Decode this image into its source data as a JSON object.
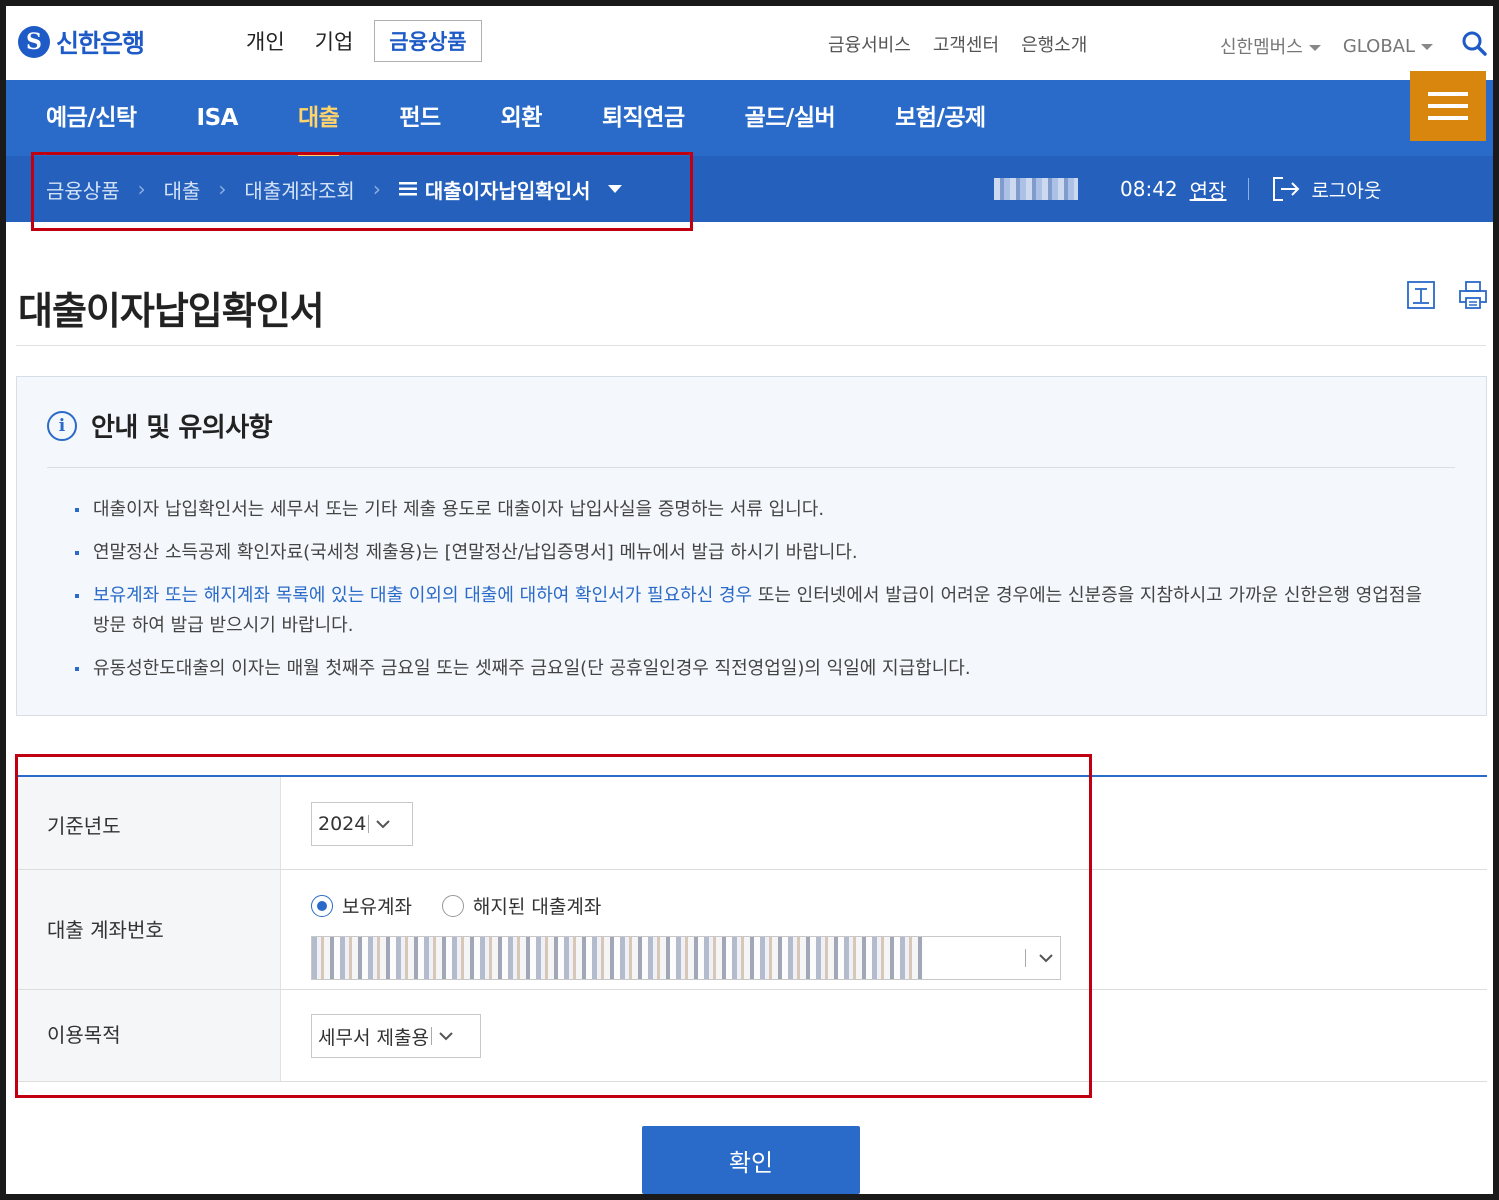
{
  "brand": {
    "name": "신한은행",
    "logo_letter": "S"
  },
  "header": {
    "main_nav": [
      "개인",
      "기업",
      "금융상품"
    ],
    "main_nav_active": "금융상품",
    "util_nav": [
      "금융서비스",
      "고객센터",
      "은행소개"
    ],
    "members": "신한멤버스",
    "global": "GLOBAL"
  },
  "gnb": {
    "items": [
      "예금/신탁",
      "ISA",
      "대출",
      "펀드",
      "외환",
      "퇴직연금",
      "골드/실버",
      "보험/공제"
    ],
    "active": "대출"
  },
  "breadcrumb": {
    "items": [
      "금융상품",
      "대출",
      "대출계좌조회"
    ],
    "current": "대출이자납입확인서"
  },
  "session": {
    "time": "08:42",
    "extend": "연장",
    "logout": "로그아웃"
  },
  "page": {
    "title": "대출이자납입확인서"
  },
  "notice": {
    "title": "안내 및 유의사항",
    "items": [
      "대출이자 납입확인서는 세무서 또는 기타 제출 용도로 대출이자 납입사실을 증명하는 서류 입니다.",
      "연말정산 소득공제 확인자료(국세청 제출용)는 [연말정산/납입증명서] 메뉴에서 발급 하시기 바랍니다."
    ],
    "item3_highlight": "보유계좌 또는 해지계좌 목록에 있는 대출 이외의 대출에 대하여 확인서가 필요하신 경우",
    "item3_rest": " 또는 인터넷에서 발급이 어려운 경우에는 신분증을 지참하시고 가까운 신한은행 영업점을 방문 하여 발급 받으시기 바랍니다.",
    "item4": "유동성한도대출의 이자는 매월 첫째주 금요일 또는 셋째주 금요일(단 공휴일인경우 직전영업일)의 익일에 지급합니다."
  },
  "form": {
    "year_label": "기준년도",
    "year_value": "2024",
    "account_label": "대출 계좌번호",
    "radio_owned": "보유계좌",
    "radio_closed": "해지된 대출계좌",
    "purpose_label": "이용목적",
    "purpose_value": "세무서 제출용"
  },
  "confirm_label": "확인",
  "colors": {
    "primary": "#2a6ac8",
    "menu": "#d9860f",
    "highlight": "#c00010",
    "gnb_active": "#ffd46b"
  }
}
